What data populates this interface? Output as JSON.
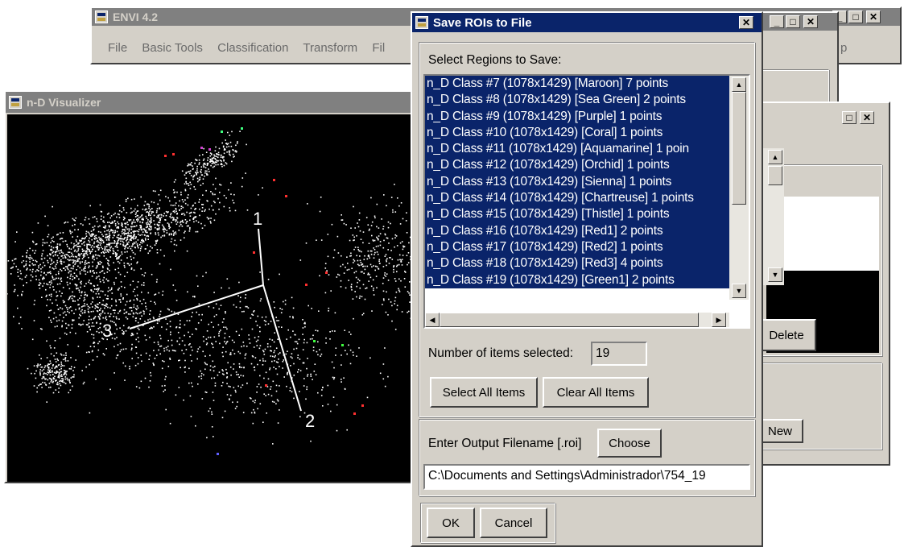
{
  "envi": {
    "title": "ENVI 4.2",
    "menu": [
      "File",
      "Basic Tools",
      "Classification",
      "Transform",
      "Fil"
    ],
    "menu_tail": "p"
  },
  "visualizer": {
    "title": "n-D Visualizer",
    "axis_labels": [
      "1",
      "2",
      "3"
    ]
  },
  "background_window": {
    "delete_label": "Delete",
    "new_label": "New"
  },
  "dialog": {
    "title": "Save ROIs to File",
    "regions_label": "Select Regions to Save:",
    "regions": [
      "n_D Class #7 (1078x1429) [Maroon] 7 points",
      "n_D Class #8 (1078x1429) [Sea Green] 2 points",
      "n_D Class #9 (1078x1429) [Purple] 1 points",
      "n_D Class #10 (1078x1429) [Coral] 1 points",
      "n_D Class #11 (1078x1429) [Aquamarine] 1 poin",
      "n_D Class #12 (1078x1429) [Orchid] 1 points",
      "n_D Class #13 (1078x1429) [Sienna] 1 points",
      "n_D Class #14 (1078x1429) [Chartreuse] 1 points",
      "n_D Class #15 (1078x1429) [Thistle] 1 points",
      "n_D Class #16 (1078x1429) [Red1] 2 points",
      "n_D Class #17 (1078x1429) [Red2] 1 points",
      "n_D Class #18 (1078x1429) [Red3] 4 points",
      "n_D Class #19 (1078x1429) [Green1] 2 points"
    ],
    "selected_count_label": "Number of items selected:",
    "selected_count": "19",
    "select_all_label": "Select All Items",
    "clear_all_label": "Clear All Items",
    "filename_label": "Enter Output Filename [.roi]",
    "choose_label": "Choose",
    "filename_value": "C:\\Documents and Settings\\Administrador\\754_19",
    "ok_label": "OK",
    "cancel_label": "Cancel"
  },
  "colors": {
    "active_title": "#0a246a",
    "inactive_title": "#808080",
    "face": "#d4d0c8",
    "selection": "#0a246a"
  }
}
